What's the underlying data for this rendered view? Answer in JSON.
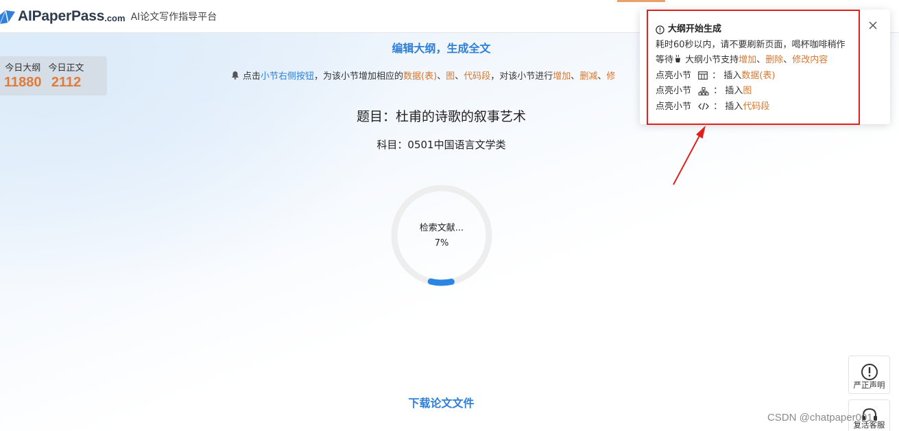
{
  "header": {
    "logo_text": "AIPaperPass",
    "logo_domain": ".com",
    "tagline": "AI论文写作指导平台"
  },
  "stats": {
    "outline_label": "今日大纲",
    "outline_value": "11880",
    "body_label": "今日正文",
    "body_value": "2112"
  },
  "main": {
    "heading": "编辑大纲，生成全文",
    "tip": {
      "p1": "点击",
      "p2": "小节右侧按钮",
      "p3": "，为该小节增加相应的",
      "p4": "数据(表)",
      "p5": "、",
      "p6": "图",
      "p7": "、",
      "p8": "代码段",
      "p9": "，对该小节进行",
      "p10": "增加",
      "p11": "、",
      "p12": "删减",
      "p13": "、",
      "p14": "修"
    },
    "title": "题目：杜甫的诗歌的叙事艺术",
    "subject": "科目：0501中国语言文学类",
    "progress": {
      "status": "检索文献...",
      "percent_label": "7%",
      "percent": 7
    },
    "download": "下载论文文件"
  },
  "notice": {
    "title": "大纲开始生成",
    "line1": "耗时60秒以内，请不要刷新页面，喝杯咖啡稍作",
    "line2_a": "等待",
    "line2_b": " 大纲小节支持",
    "line2_add": "增加",
    "line2_sep1": "、",
    "line2_del": "删除",
    "line2_sep2": "、",
    "line2_edit": "修改内容",
    "row_prefix": "点亮小节",
    "row_colon": "：",
    "row_insert": "插入",
    "row1_item": "数据(表)",
    "row2_item": "图",
    "row3_item": "代码段"
  },
  "side": {
    "statement": "严正声明",
    "contact": "复活客服"
  },
  "watermark": "CSDN @chatpaper001",
  "colors": {
    "accent_blue": "#2f7fd8",
    "accent_orange": "#d8772e",
    "stat_orange": "#e07b3a",
    "highlight_red": "#e0201a"
  },
  "icons": [
    "logo-icon",
    "bell-icon",
    "info-icon",
    "close-icon",
    "table-icon",
    "tree-icon",
    "code-icon",
    "coffee-icon",
    "exclamation-icon",
    "headset-icon"
  ]
}
